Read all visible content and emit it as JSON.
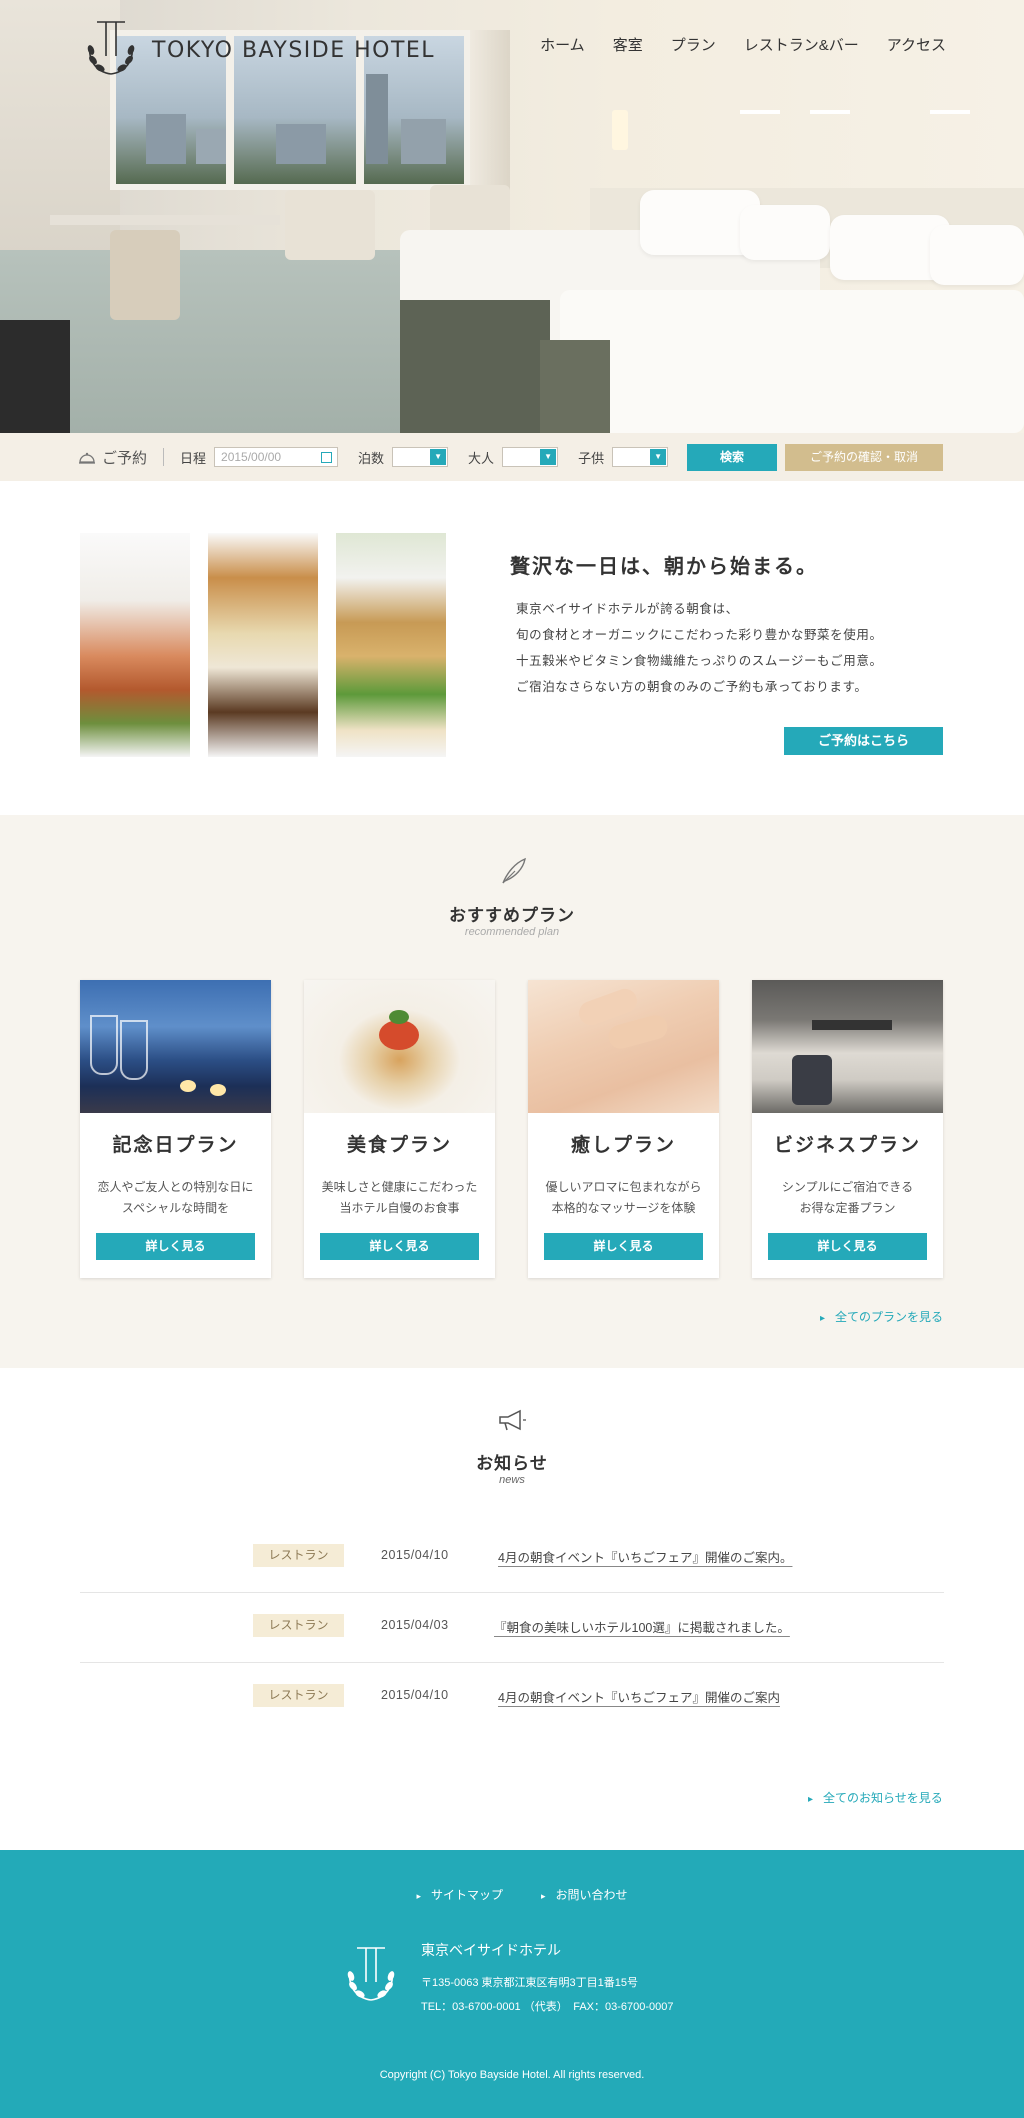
{
  "site": {
    "logo_text": "TOKYO BAYSIDE HOTEL"
  },
  "nav": [
    "ホーム",
    "客室",
    "プラン",
    "レストラン&バー",
    "アクセス"
  ],
  "reservation": {
    "title": "ご予約",
    "date_label": "日程",
    "date_placeholder": "2015/00/00",
    "nights_label": "泊数",
    "adults_label": "大人",
    "children_label": "子供",
    "search_label": "検索",
    "confirm_label": "ご予約の確認・取消"
  },
  "breakfast": {
    "title": "贅沢な一日は、朝から始まる。",
    "lines": [
      "東京ベイサイドホテルが誇る朝食は、",
      "旬の食材とオーガニックにこだわった彩り豊かな野菜を使用。",
      "十五穀米やビタミン食物繊維たっぷりのスムージーもご用意。",
      "ご宿泊なさらない方の朝食のみのご予約も承っております。"
    ],
    "button": "ご予約はこちら"
  },
  "plans": {
    "title": "おすすめプラン",
    "subtitle": "recommended plan",
    "items": [
      {
        "name": "記念日プラン",
        "desc1": "恋人やご友人との特別な日に",
        "desc2": "スペシャルな時間を",
        "button": "詳しく見る"
      },
      {
        "name": "美食プラン",
        "desc1": "美味しさと健康にこだわった",
        "desc2": "当ホテル自慢のお食事",
        "button": "詳しく見る"
      },
      {
        "name": "癒しプラン",
        "desc1": "優しいアロマに包まれながら",
        "desc2": "本格的なマッサージを体験",
        "button": "詳しく見る"
      },
      {
        "name": "ビジネスプラン",
        "desc1": "シンプルにご宿泊できる",
        "desc2": "お得な定番プラン",
        "button": "詳しく見る"
      }
    ],
    "more": "全てのプランを見る"
  },
  "news": {
    "title": "お知らせ",
    "subtitle": "news",
    "items": [
      {
        "tag": "レストラン",
        "date": "2015/04/10",
        "title": "4月の朝食イベント『いちごフェア』開催のご案内。"
      },
      {
        "tag": "レストラン",
        "date": "2015/04/03",
        "title": "『朝食の美味しいホテル100選』に掲載されました。"
      },
      {
        "tag": "レストラン",
        "date": "2015/04/10",
        "title": "4月の朝食イベント『いちごフェア』開催のご案内"
      }
    ],
    "more": "全てのお知らせを見る"
  },
  "footer": {
    "links": [
      "サイトマップ",
      "お問い合わせ"
    ],
    "name": "東京ベイサイドホテル",
    "address": "〒135-0063 東京都江東区有明3丁目1番15号",
    "tel": "TEL：03-6700-0001 （代表）　FAX：03-6700-0007",
    "copyright": "Copyright (C) Tokyo Bayside Hotel. All rights reserved."
  },
  "colors": {
    "accent": "#25a9b9",
    "gold": "#d2bd8e",
    "beige": "#f7f4ee"
  }
}
